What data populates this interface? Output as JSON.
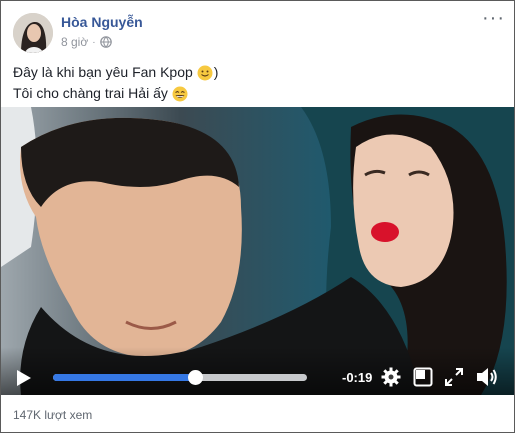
{
  "post": {
    "author": "Hòa Nguyễn",
    "time": "8 giờ",
    "privacy_icon": "globe-icon",
    "line1_text": "Đây là khi bạn yêu Fan Kpop",
    "line1_suffix": ")",
    "line1_emoji": "slightly-smiling-emoji",
    "line2_text": "Tôi cho chàng trai ",
    "line2_link": "Hải ấy",
    "line2_emoji": "laughing-emoji"
  },
  "video": {
    "remaining_time": "-0:19",
    "progress": 0.56,
    "volume_icon": "volume-icon",
    "settings_icon": "gear-icon",
    "pip_icon": "picture-in-picture-icon",
    "fullscreen_icon": "fullscreen-icon",
    "play_icon": "play-icon",
    "accent_color": "#3578e5"
  },
  "footer": {
    "views": "147K lượt xem"
  }
}
